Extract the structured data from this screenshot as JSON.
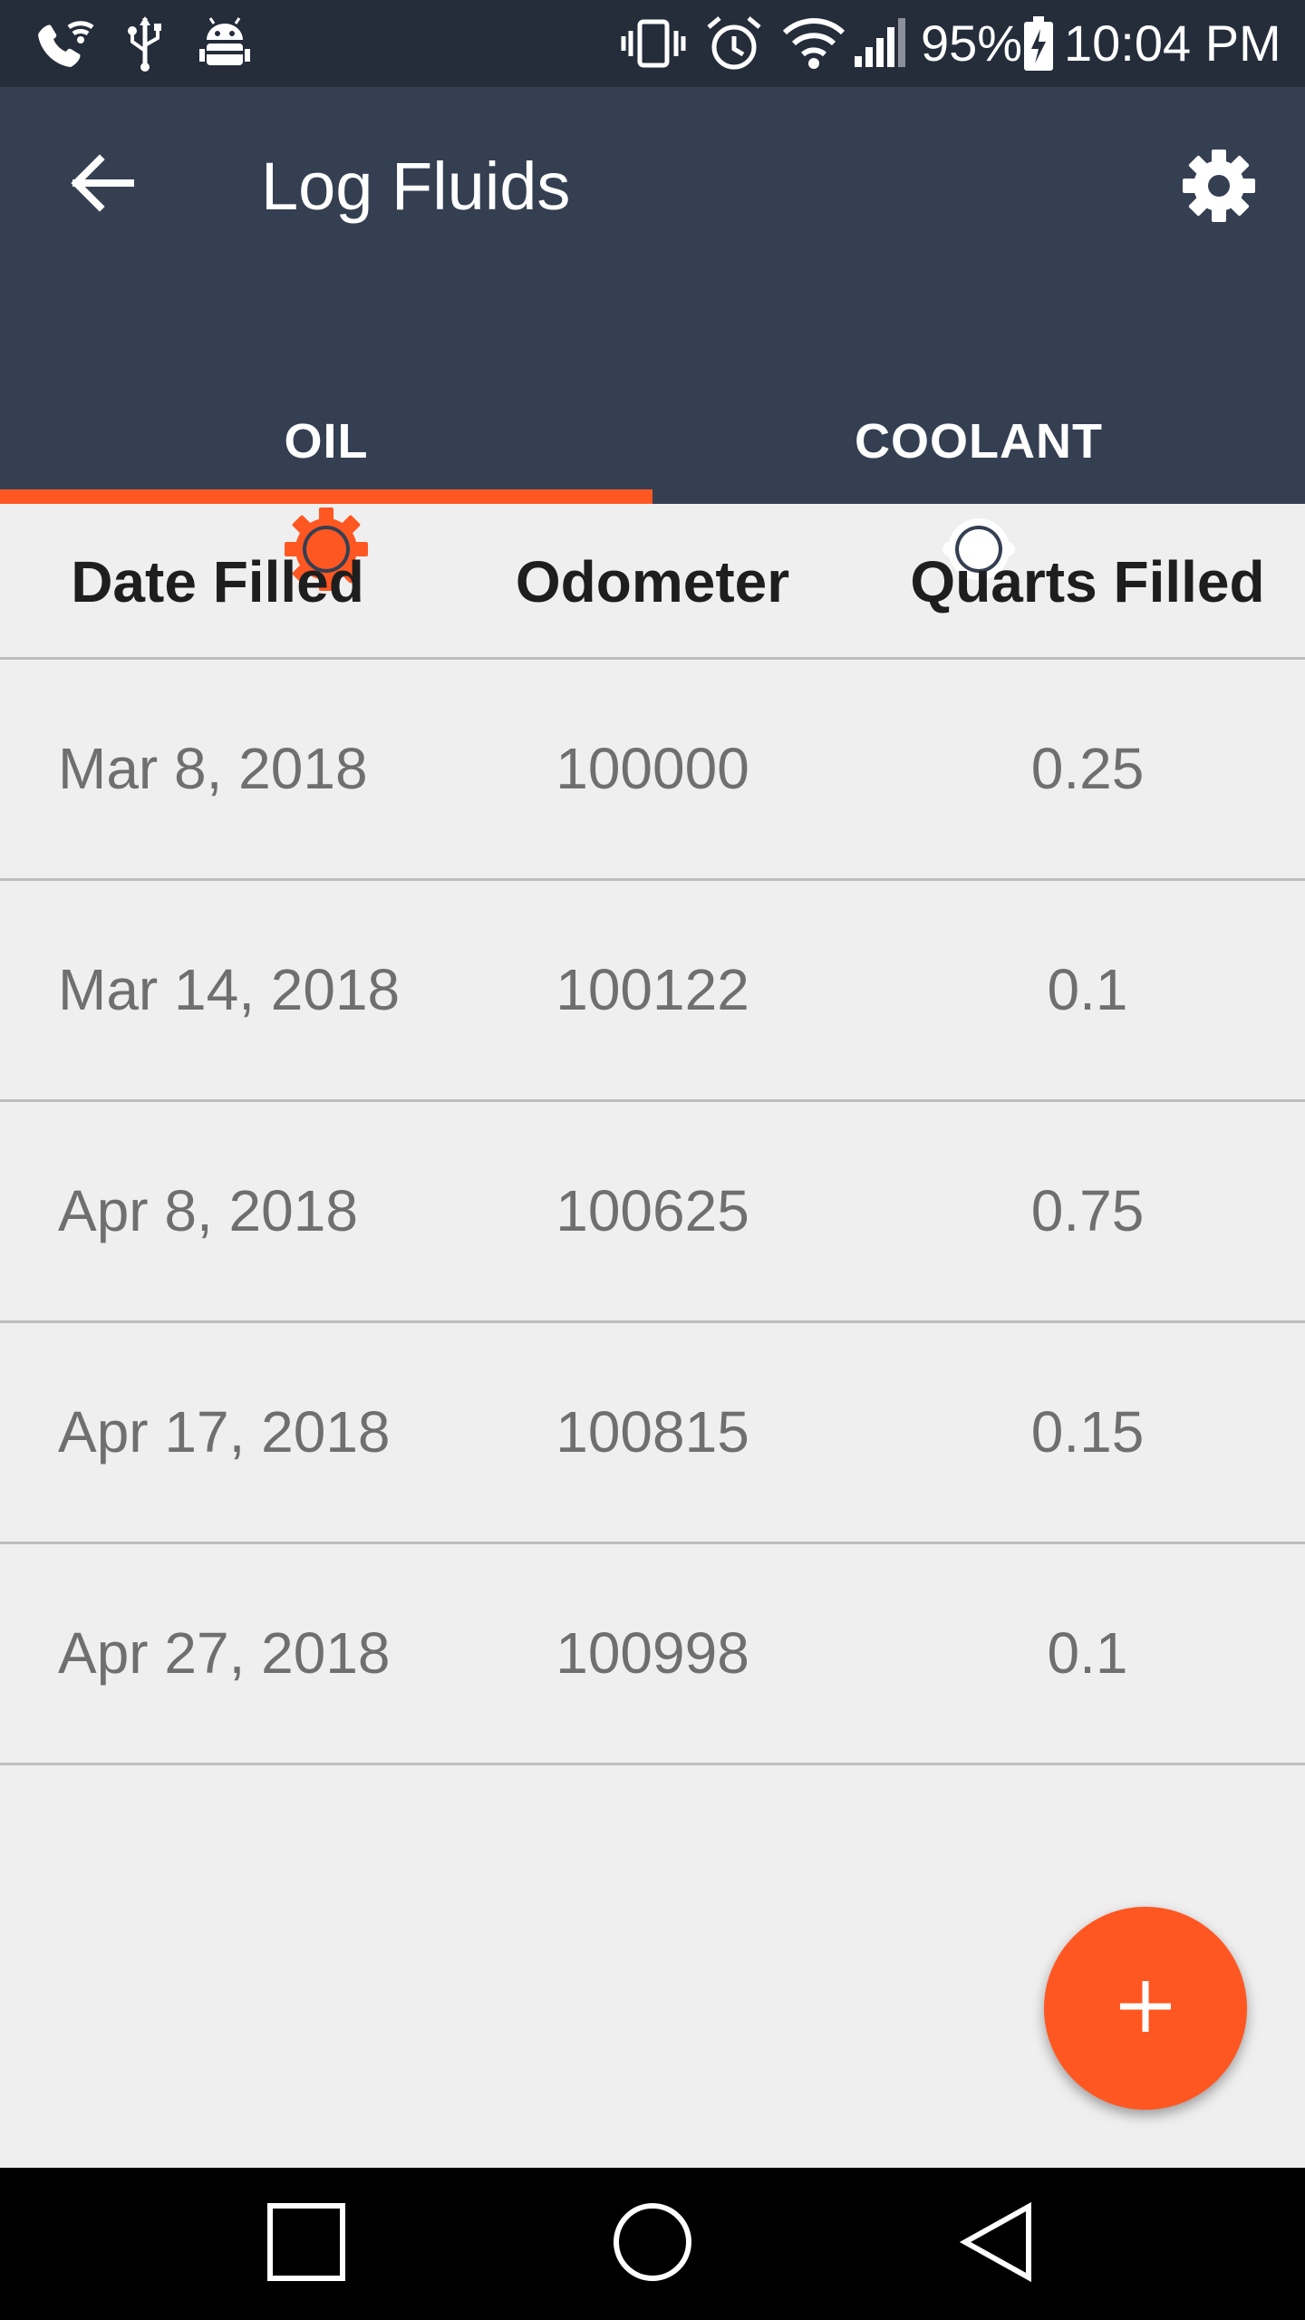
{
  "status_bar": {
    "battery": "95%",
    "time": "10:04 PM",
    "icons": [
      "wifi-calling-icon",
      "usb-icon",
      "android-debug-icon",
      "vibrate-icon",
      "alarm-icon",
      "wifi-icon",
      "signal-icon",
      "battery-charging-icon"
    ]
  },
  "app_bar": {
    "title": "Log Fluids",
    "back_icon": "arrow-back-icon",
    "settings_icon": "gear-icon"
  },
  "tabs": [
    {
      "label": "OIL",
      "icon": "oil-gear-icon",
      "selected": true
    },
    {
      "label": "COOLANT",
      "icon": "coolant-icon",
      "selected": false
    }
  ],
  "colors": {
    "status_bar": "#252d3b",
    "app_bar": "#353f52",
    "accent": "#ff5722",
    "background": "#efefef"
  },
  "table": {
    "columns": [
      "Date Filled",
      "Odometer",
      "Quarts Filled"
    ],
    "rows": [
      {
        "date": "Mar 8, 2018",
        "odometer": "100000",
        "quarts": "0.25"
      },
      {
        "date": "Mar 14, 2018",
        "odometer": "100122",
        "quarts": "0.1"
      },
      {
        "date": "Apr 8, 2018",
        "odometer": "100625",
        "quarts": "0.75"
      },
      {
        "date": "Apr 17, 2018",
        "odometer": "100815",
        "quarts": "0.15"
      },
      {
        "date": "Apr 27, 2018",
        "odometer": "100998",
        "quarts": "0.1"
      }
    ]
  },
  "fab": {
    "icon": "plus-icon"
  },
  "nav_bar": {
    "buttons": [
      "recents-square-icon",
      "home-circle-icon",
      "back-triangle-icon"
    ]
  }
}
